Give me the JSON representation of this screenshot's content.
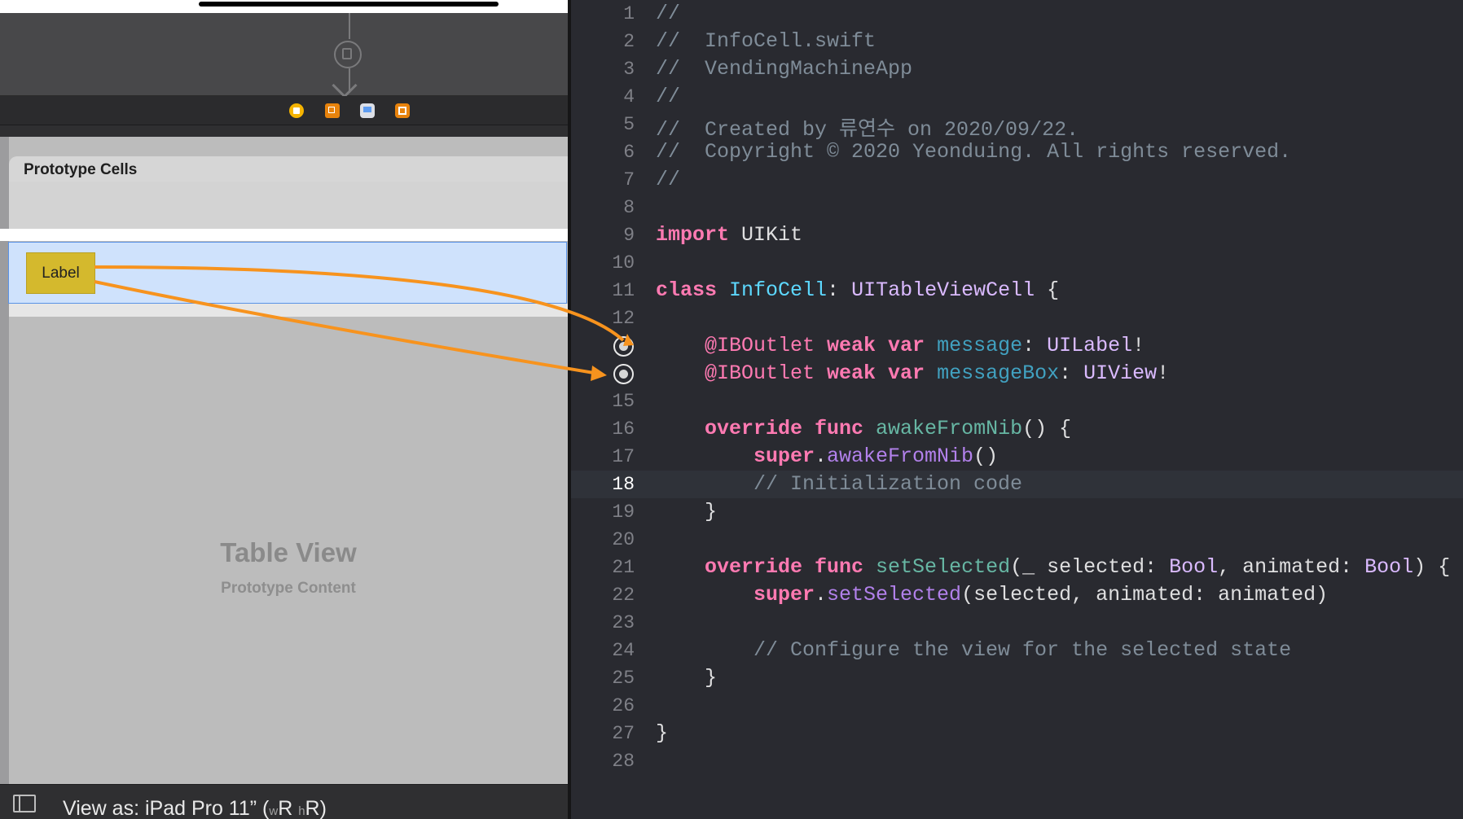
{
  "storyboard": {
    "prototype_cells_header": "Prototype Cells",
    "cell_label": "Label",
    "table_view_title": "Table View",
    "table_view_subtitle": "Prototype Content",
    "view_as_prefix": "View as: iPad Pro 11” (",
    "view_as_w": "w",
    "view_as_R1": "R ",
    "view_as_h": "h",
    "view_as_R2": "R)",
    "dock_icons": [
      "view-controller-icon",
      "first-responder-icon",
      "view-icon",
      "exit-icon"
    ]
  },
  "editor": {
    "current_line": 18,
    "lines": [
      {
        "n": "1",
        "t": "//"
      },
      {
        "n": "2",
        "t": "//  InfoCell.swift"
      },
      {
        "n": "3",
        "t": "//  VendingMachineApp"
      },
      {
        "n": "4",
        "t": "//"
      },
      {
        "n": "5",
        "t": "//  Created by 류연수 on 2020/09/22."
      },
      {
        "n": "6",
        "t": "//  Copyright © 2020 Yeonduing. All rights reserved."
      },
      {
        "n": "7",
        "t": "//"
      },
      {
        "n": "8",
        "t": ""
      },
      {
        "n": "9",
        "kw": "import",
        "rest": " UIKit"
      },
      {
        "n": "10",
        "t": ""
      },
      {
        "n": "11",
        "kw": "class",
        "name": " InfoCell",
        "colon": ": ",
        "sup": "UITableViewCell",
        "tail": " {"
      },
      {
        "n": "12",
        "t": ""
      },
      {
        "n": "",
        "attr": "@IBOutlet",
        "kw1": " weak",
        "kw2": " var",
        "prop": " message",
        "colon": ": ",
        "type": "UILabel",
        "tail": "!"
      },
      {
        "n": "",
        "attr": "@IBOutlet",
        "kw1": " weak",
        "kw2": " var",
        "prop": " messageBox",
        "colon": ": ",
        "type": "UIView",
        "tail": "!"
      },
      {
        "n": "15",
        "t": ""
      },
      {
        "n": "16",
        "kw1": "override",
        "kw2": " func",
        "fn": " awakeFromNib",
        "tail": "() {"
      },
      {
        "n": "17",
        "kw": "super",
        "dot": ".",
        "fnref": "awakeFromNib",
        "tail": "()"
      },
      {
        "n": "18",
        "t": "// Initialization code"
      },
      {
        "n": "19",
        "t": "}"
      },
      {
        "n": "20",
        "t": ""
      },
      {
        "n": "21",
        "kw1": "override",
        "kw2": " func",
        "fn": " setSelected",
        "p1": "(_ selected: ",
        "type1": "Bool",
        "p2": ", animated: ",
        "type2": "Bool",
        "tail": ") {"
      },
      {
        "n": "22",
        "kw": "super",
        "dot": ".",
        "fnref": "setSelected",
        "tail": "(selected, animated: animated)"
      },
      {
        "n": "23",
        "t": ""
      },
      {
        "n": "24",
        "t": "// Configure the view for the selected state"
      },
      {
        "n": "25",
        "t": "}"
      },
      {
        "n": "26",
        "t": ""
      },
      {
        "n": "27",
        "t": "}"
      },
      {
        "n": "28",
        "t": ""
      }
    ]
  },
  "colors": {
    "connection_arrow": "#f7931e",
    "editor_bg": "#292a30",
    "keyword": "#ff7ab2",
    "comment": "#7f8c98"
  }
}
